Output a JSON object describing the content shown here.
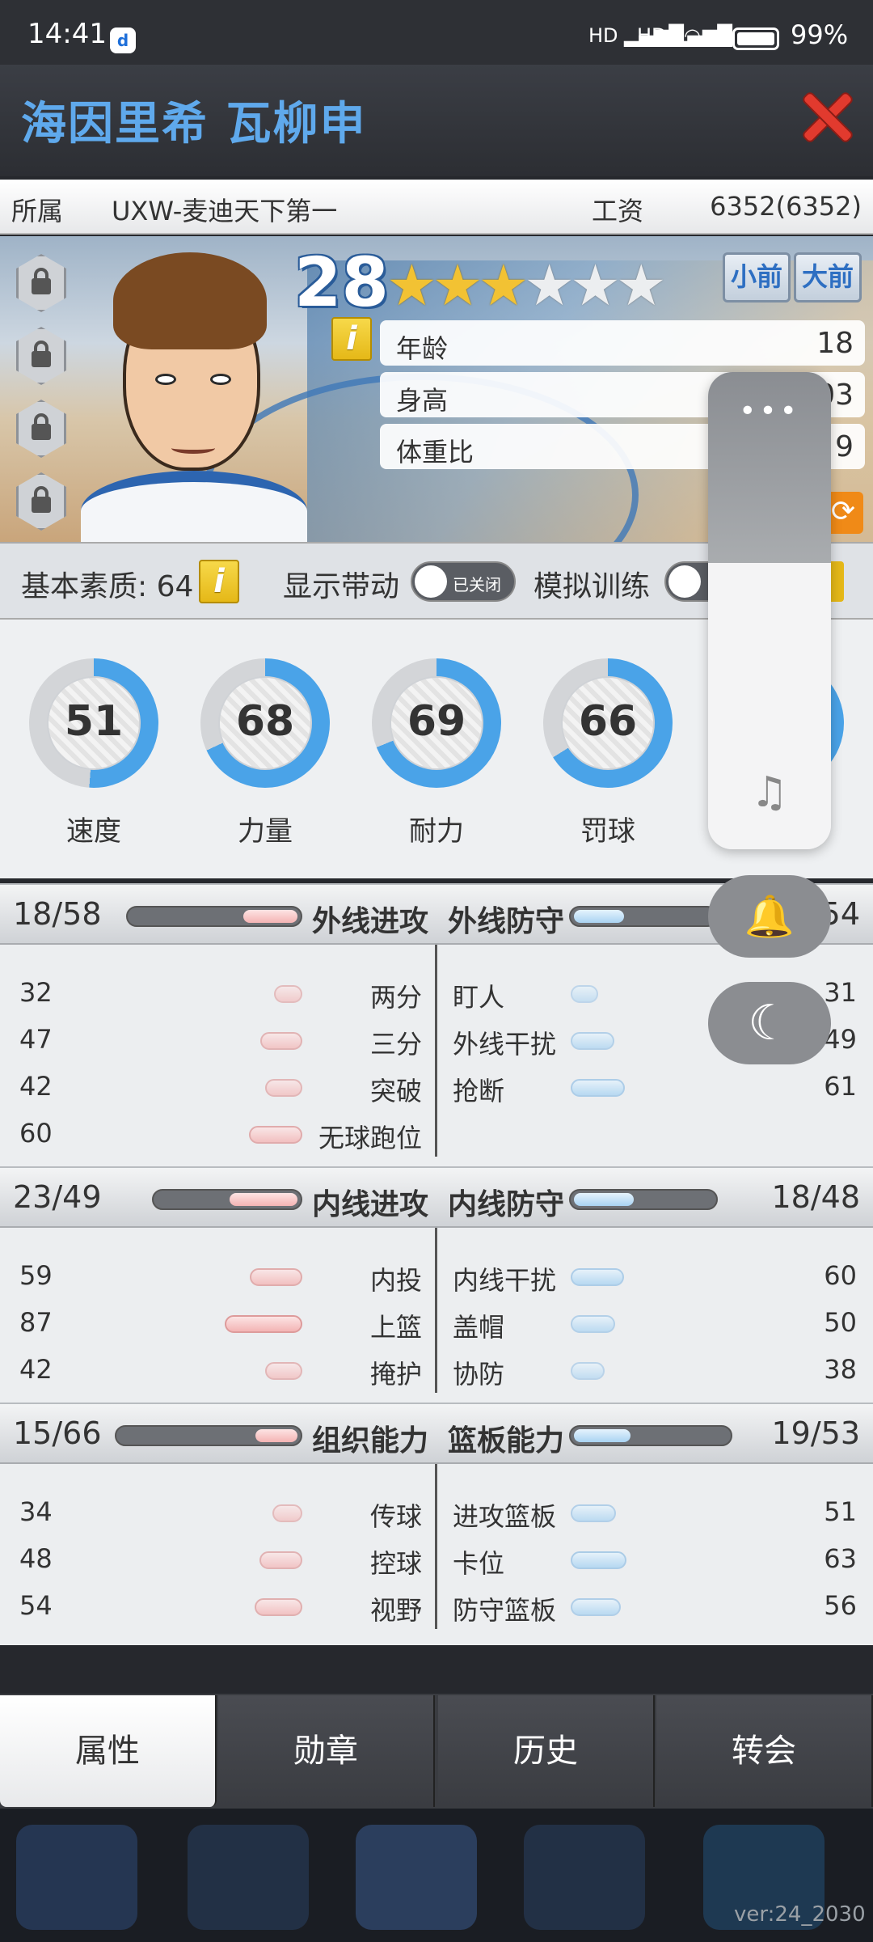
{
  "status": {
    "time": "14:41",
    "battery": "99%",
    "signal": "HD",
    "app_icon": "d"
  },
  "header": {
    "title": "海因里希 瓦柳申"
  },
  "info": {
    "team_label": "所属",
    "team_value": "UXW-麦迪天下第一",
    "salary_label": "工资",
    "salary_value": "6352(6352)"
  },
  "player": {
    "overall": "28",
    "stars_on": 3,
    "stars_total": 6,
    "positions": [
      "小前",
      "大前"
    ],
    "info_icon": "i",
    "attrs": [
      {
        "label": "年龄",
        "value": "18"
      },
      {
        "label": "身高",
        "value": "03"
      },
      {
        "label": "体重比",
        "value": "9"
      }
    ]
  },
  "basic": {
    "label": "基本素质: 64",
    "show_label": "显示带动",
    "toggle_text": "已关闭",
    "sim_label": "模拟训练"
  },
  "gauges": [
    {
      "label": "速度",
      "value": 51
    },
    {
      "label": "力量",
      "value": 68
    },
    {
      "label": "耐力",
      "value": 69
    },
    {
      "label": "罚球",
      "value": 66
    },
    {
      "label": "",
      "value": 60
    }
  ],
  "sections": [
    {
      "left_title": "外线进攻",
      "left_count": "18/58",
      "left_fill": 0.32,
      "right_title": "外线防守",
      "right_count": "54",
      "right_fill": 0.35,
      "rows": [
        {
          "ln": "32",
          "lk": "两分",
          "rk": "盯人",
          "rn": "31",
          "lv": 32,
          "rv": 31
        },
        {
          "ln": "47",
          "lk": "三分",
          "rk": "外线干扰",
          "rn": "49",
          "lv": 47,
          "rv": 49
        },
        {
          "ln": "42",
          "lk": "突破",
          "rk": "抢断",
          "rn": "61",
          "lv": 42,
          "rv": 61
        },
        {
          "ln": "60",
          "lk": "无球跑位",
          "rk": "",
          "rn": "",
          "lv": 60,
          "rv": 0
        }
      ]
    },
    {
      "left_title": "内线进攻",
      "left_count": "23/49",
      "left_fill": 0.47,
      "right_title": "内线防守",
      "right_count": "18/48",
      "right_fill": 0.42,
      "rows": [
        {
          "ln": "59",
          "lk": "内投",
          "rk": "内线干扰",
          "rn": "60",
          "lv": 59,
          "rv": 60
        },
        {
          "ln": "87",
          "lk": "上篮",
          "rk": "盖帽",
          "rn": "50",
          "lv": 87,
          "rv": 50
        },
        {
          "ln": "42",
          "lk": "掩护",
          "rk": "协防",
          "rn": "38",
          "lv": 42,
          "rv": 38
        }
      ]
    },
    {
      "left_title": "组织能力",
      "left_count": "15/66",
      "left_fill": 0.23,
      "right_title": "篮板能力",
      "right_count": "19/53",
      "right_fill": 0.36,
      "rows": [
        {
          "ln": "34",
          "lk": "传球",
          "rk": "进攻篮板",
          "rn": "51",
          "lv": 34,
          "rv": 51
        },
        {
          "ln": "48",
          "lk": "控球",
          "rk": "卡位",
          "rn": "63",
          "lv": 48,
          "rv": 63
        },
        {
          "ln": "54",
          "lk": "视野",
          "rk": "防守篮板",
          "rn": "56",
          "lv": 54,
          "rv": 56
        }
      ]
    }
  ],
  "tabs": [
    "属性",
    "勋章",
    "历史",
    "转会"
  ],
  "active_tab": 0,
  "version": "ver:24_2030",
  "floating": {
    "dots": "•••",
    "music_icon": "♫",
    "bell_icon": "🔔",
    "moon_icon": "☾"
  },
  "colors": {
    "accent_blue": "#4aa3e8",
    "title_blue": "#5fa9ec",
    "close_red": "#e23a2e",
    "pink_bar": "#f4b3b3",
    "blue_bar": "#a9d3f2"
  }
}
